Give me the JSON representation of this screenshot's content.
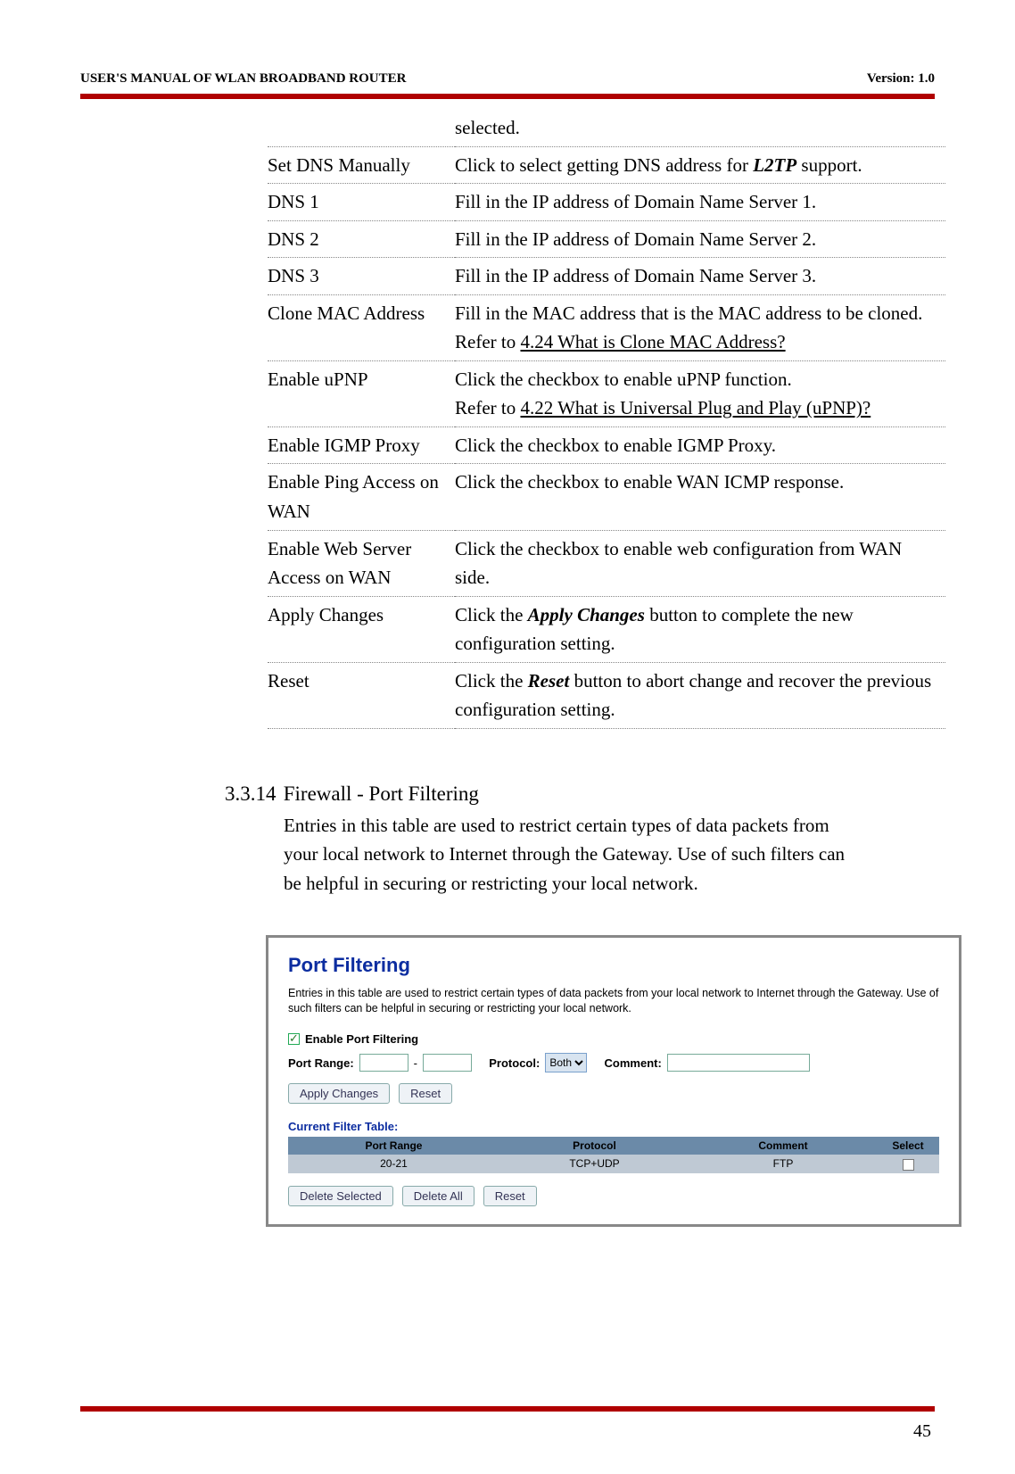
{
  "header": {
    "left": "USER'S MANUAL OF WLAN BROADBAND ROUTER",
    "right": "Version: 1.0"
  },
  "defs": [
    {
      "term": "",
      "desc_pre": "",
      "desc_post": "selected."
    },
    {
      "term": "Set DNS Manually",
      "desc_pre": "Click to select getting DNS address for ",
      "ital": "L2TP",
      "desc_post": " support."
    },
    {
      "term": "DNS 1",
      "desc_pre": "Fill in the IP address of Domain Name Server 1.",
      "desc_post": ""
    },
    {
      "term": "DNS 2",
      "desc_pre": "Fill in the IP address of Domain Name Server 2.",
      "desc_post": ""
    },
    {
      "term": "DNS 3",
      "desc_pre": "Fill in the IP address of Domain Name Server 3.",
      "desc_post": ""
    },
    {
      "term": "Clone MAC Address",
      "desc_pre": "Fill in the MAC address that is the MAC address to be cloned. Refer to ",
      "link": "4.24 What is Clone MAC Address?",
      "desc_post": ""
    },
    {
      "term": "Enable uPNP",
      "desc_pre": "Click the checkbox to enable uPNP function.\nRefer to ",
      "link": "4.22 What is Universal Plug and Play (uPNP)?",
      "desc_post": ""
    },
    {
      "term": "Enable IGMP Proxy",
      "desc_pre": "Click the checkbox to enable IGMP Proxy.",
      "desc_post": ""
    },
    {
      "term": "Enable Ping Access on WAN",
      "desc_pre": "Click the checkbox to enable WAN ICMP response.",
      "desc_post": ""
    },
    {
      "term": "Enable Web Server Access on WAN",
      "desc_pre": "Click the checkbox to enable web configuration from WAN side.",
      "desc_post": ""
    },
    {
      "term": "Apply Changes",
      "desc_pre": "Click the ",
      "ital": "Apply Changes",
      "desc_post": " button to complete the new configuration setting."
    },
    {
      "term": "Reset",
      "desc_pre": "Click the ",
      "ital": "Reset",
      "desc_post": " button to abort change and recover the previous configuration setting."
    }
  ],
  "section": {
    "num": "3.3.14",
    "title": "Firewall - Port Filtering",
    "intro": "Entries in this table are used to restrict certain types of data packets from your local network to Internet through the Gateway. Use of such filters can be helpful in securing or restricting your local network."
  },
  "panel": {
    "title": "Port Filtering",
    "desc": "Entries in this table are used to restrict certain types of data packets from your local network to Internet through the Gateway. Use of such filters can be helpful in securing or restricting your local network.",
    "enable_label": "Enable Port Filtering",
    "labels": {
      "portrange": "Port Range:",
      "protocol": "Protocol:",
      "comment": "Comment:"
    },
    "protocol_value": "Both",
    "buttons": {
      "apply": "Apply Changes",
      "reset": "Reset",
      "delsel": "Delete Selected",
      "delall": "Delete All",
      "reset2": "Reset"
    },
    "table_title": "Current Filter Table:",
    "table_headers": {
      "c1": "Port Range",
      "c2": "Protocol",
      "c3": "Comment",
      "c4": "Select"
    },
    "table_rows": [
      {
        "c1": "20-21",
        "c2": "TCP+UDP",
        "c3": "FTP"
      }
    ]
  },
  "page_number": "45"
}
